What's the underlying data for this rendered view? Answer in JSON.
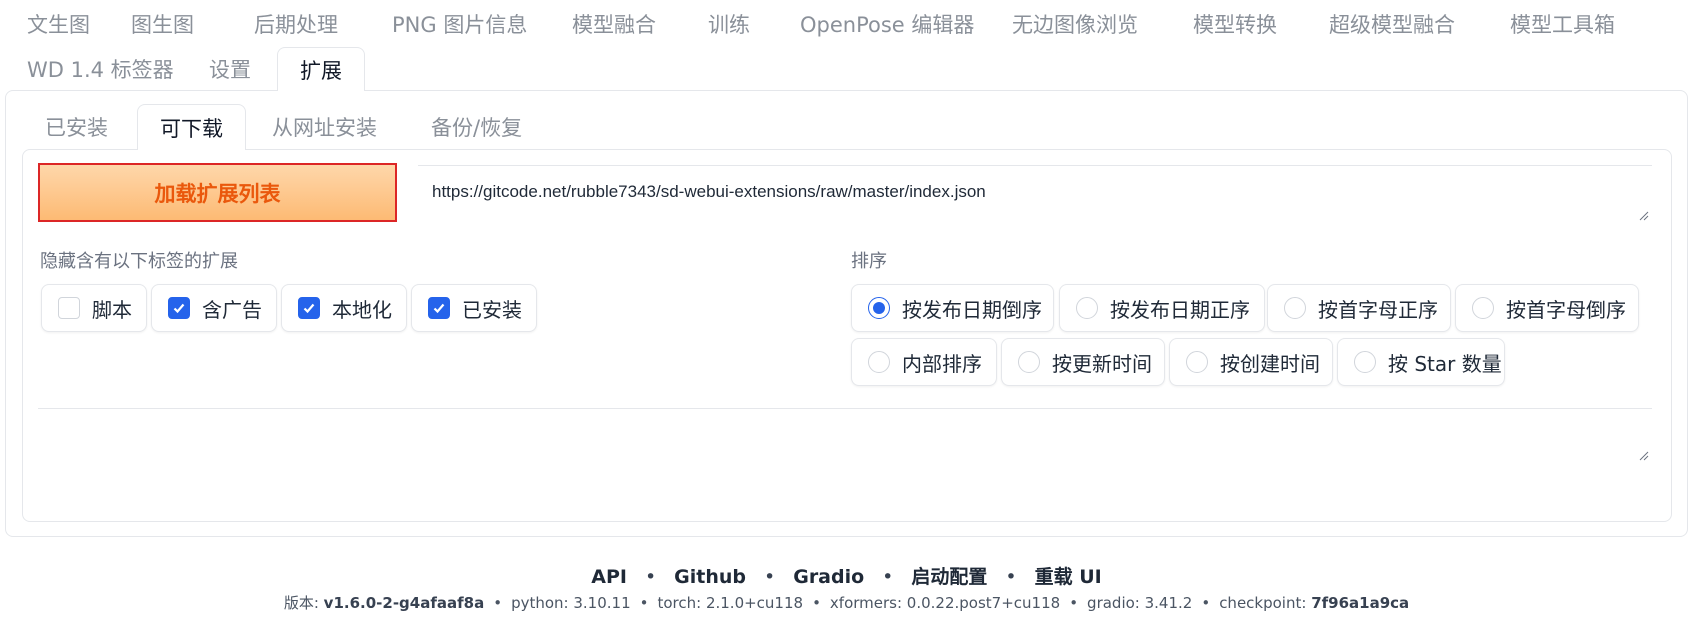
{
  "top_tabs": {
    "row1": [
      "文生图",
      "图生图",
      "后期处理",
      "PNG 图片信息",
      "模型融合",
      "训练",
      "OpenPose 编辑器",
      "无边图像浏览",
      "模型转换",
      "超级模型融合",
      "模型工具箱"
    ],
    "row2": [
      "WD 1.4 标签器",
      "设置",
      "扩展"
    ],
    "active": "扩展"
  },
  "sub_tabs": {
    "items": [
      "已安装",
      "可下载",
      "从网址安装",
      "备份/恢复"
    ],
    "active": "可下载"
  },
  "load_button": "加载扩展列表",
  "url_value": "https://gitcode.net/rubble7343/sd-webui-extensions/raw/master/index.json",
  "hide_section": {
    "label": "隐藏含有以下标签的扩展",
    "options": [
      {
        "label": "脚本",
        "checked": false
      },
      {
        "label": "含广告",
        "checked": true
      },
      {
        "label": "本地化",
        "checked": true
      },
      {
        "label": "已安装",
        "checked": true
      }
    ]
  },
  "sort_section": {
    "label": "排序",
    "options": [
      {
        "label": "按发布日期倒序",
        "checked": true
      },
      {
        "label": "按发布日期正序",
        "checked": false
      },
      {
        "label": "按首字母正序",
        "checked": false
      },
      {
        "label": "按首字母倒序",
        "checked": false
      },
      {
        "label": "内部排序",
        "checked": false
      },
      {
        "label": "按更新时间",
        "checked": false
      },
      {
        "label": "按创建时间",
        "checked": false
      },
      {
        "label": "按 Star 数量",
        "checked": false
      }
    ]
  },
  "footer": {
    "links": [
      "API",
      "Github",
      "Gradio",
      "启动配置",
      "重载 UI"
    ],
    "version_label": "版本:",
    "version": "v1.6.0-2-g4afaaf8a",
    "python": "python: 3.10.11",
    "torch": "torch: 2.1.0+cu118",
    "xformers": "xformers: 0.0.22.post7+cu118",
    "gradio": "gradio: 3.41.2",
    "checkpoint_label": "checkpoint:",
    "checkpoint": "7f96a1a9ca"
  },
  "colors": {
    "accent": "#2563eb",
    "load_button_text": "#ea580c",
    "load_button_border": "#dc2626"
  }
}
